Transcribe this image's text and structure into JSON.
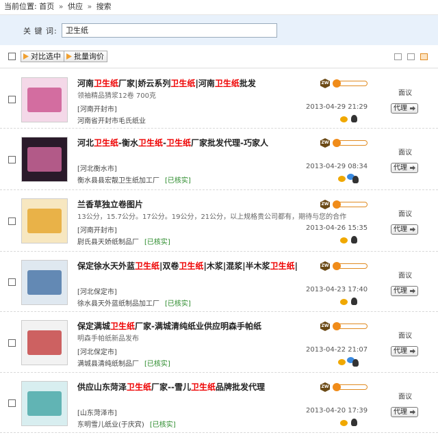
{
  "breadcrumb": {
    "prefix": "当前位置:",
    "home": "首页",
    "sep": "»",
    "supply": "供应",
    "search": "搜索"
  },
  "search": {
    "label": "关 键 词:",
    "value": "卫生纸"
  },
  "toolbar": {
    "compare": "对比选中",
    "inquiry": "批量询价"
  },
  "common": {
    "price": "面议",
    "agent": "代理",
    "verified": "[已核实]"
  },
  "results": [
    {
      "title_parts": [
        "河南",
        "卫生纸",
        "厂家|娇云系列",
        "卫生纸",
        "|河南",
        "卫生纸",
        "批发"
      ],
      "desc": "领袖精品猜浆12卷  700克",
      "location": "[河南开封市]",
      "company": "河南省开封市毛氏纸业",
      "verified": false,
      "date": "2013-04-29 21:29"
    },
    {
      "title_parts": [
        "河北",
        "卫生纸",
        "-衡水",
        "卫生纸",
        "-",
        "卫生纸",
        "厂家批发代理-巧家人"
      ],
      "desc": "",
      "location": "[河北衡水市]",
      "company": "衡水县县宏靓卫生纸加工厂",
      "verified": true,
      "date": "2013-04-29 08:34"
    },
    {
      "title_parts": [
        "兰香草独立卷图片"
      ],
      "desc": "13公分，15.7公分。17公分。19公分，21公分，以上规格贵公司都有，期待与您的合作",
      "location": "[河南开封市]",
      "company": "尉氏县天娇纸制品厂",
      "verified": true,
      "date": "2013-04-26 15:35"
    },
    {
      "title_parts": [
        "保定徐水天外蓝",
        "卫生纸",
        "|双卷",
        "卫生纸",
        "|木浆|混浆|半木浆",
        "卫生纸",
        "|"
      ],
      "desc": "",
      "location": "[河北保定市]",
      "company": "徐水县天外蓝纸制品加工厂",
      "verified": true,
      "date": "2013-04-23 17:40"
    },
    {
      "title_parts": [
        "保定满城",
        "卫生纸",
        "厂家-满城清纯纸业供应明森手帕纸"
      ],
      "desc": "明森手帕纸新品发布",
      "location": "[河北保定市]",
      "company": "满城县清纯纸制品厂",
      "verified": true,
      "date": "2013-04-22 21:07"
    },
    {
      "title_parts": [
        "供应山东菏泽",
        "卫生纸",
        "厂家--雪儿",
        "卫生纸",
        "品牌批发代理"
      ],
      "desc": "",
      "location": "[山东菏泽市]",
      "company": "东明雪儿纸业(于庆宾)",
      "verified": true,
      "date": "2013-04-20 17:39"
    }
  ]
}
